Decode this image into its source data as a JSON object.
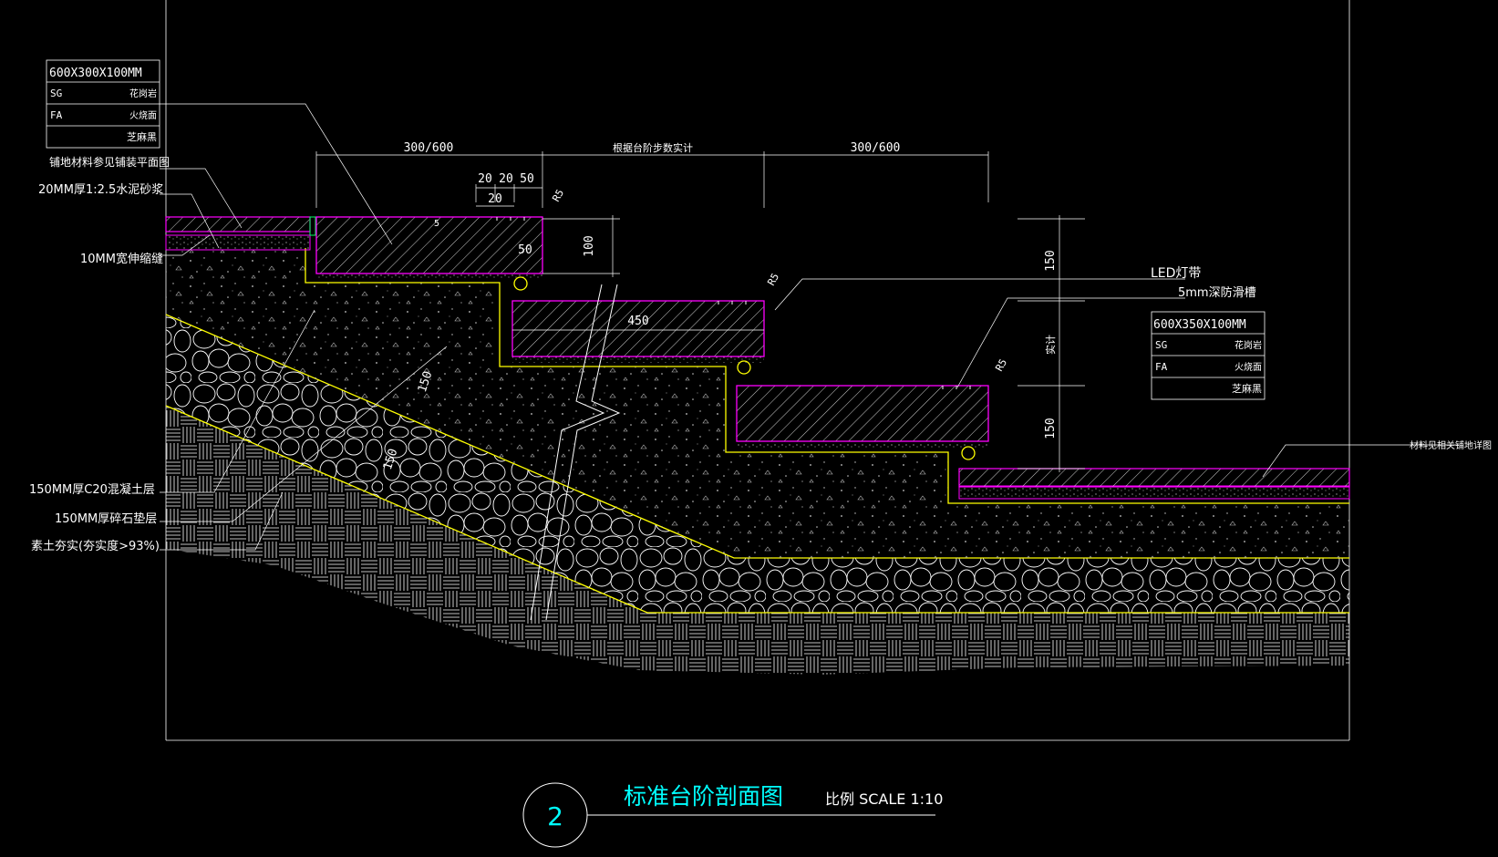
{
  "colors": {
    "background": "#000000",
    "line": "#ffffff",
    "paving_outline": "#ff00ff",
    "subgrade_line": "#ffff00",
    "title": "#00ffff"
  },
  "legend_top": {
    "header": "600X300X100MM",
    "rows": [
      {
        "code": "SG",
        "value": "花岗岩"
      },
      {
        "code": "FA",
        "value": "火烧面"
      },
      {
        "code": "",
        "value": "芝麻黑"
      }
    ]
  },
  "legend_right": {
    "header": "600X350X100MM",
    "rows": [
      {
        "code": "SG",
        "value": "花岗岩"
      },
      {
        "code": "FA",
        "value": "火烧面"
      },
      {
        "code": "",
        "value": "芝麻黑"
      }
    ]
  },
  "left_labels": {
    "paving_ref": "铺地材料参见铺装平面图",
    "mortar": "20MM厚1:2.5水泥砂浆",
    "joint": "10MM宽伸缩缝",
    "concrete": "150MM厚C20混凝土层",
    "gravel": "150MM厚碎石垫层",
    "soil": "素土夯实(夯实度>93%)"
  },
  "right_labels": {
    "led": "LED灯带",
    "groove": "5mm深防滑槽",
    "material_ref": "材料见相关铺地详图"
  },
  "dimensions": {
    "tread_left": "300/600",
    "tread_mid": "根据台阶步数实计",
    "tread_right": "300/600",
    "d20a": "20",
    "d20b": "20",
    "d50": "50",
    "d20c": "20",
    "d5": "5",
    "d50b": "50",
    "d100": "100",
    "d450": "450",
    "r5a": "R5",
    "r5b": "R5",
    "r5c": "R5",
    "h150a": "150",
    "h_var": "实计",
    "h150b": "150",
    "slope150a": "150",
    "slope150b": "150"
  },
  "title": {
    "number": "2",
    "name": "标准台阶剖面图",
    "scale": "比例 SCALE 1:10"
  }
}
